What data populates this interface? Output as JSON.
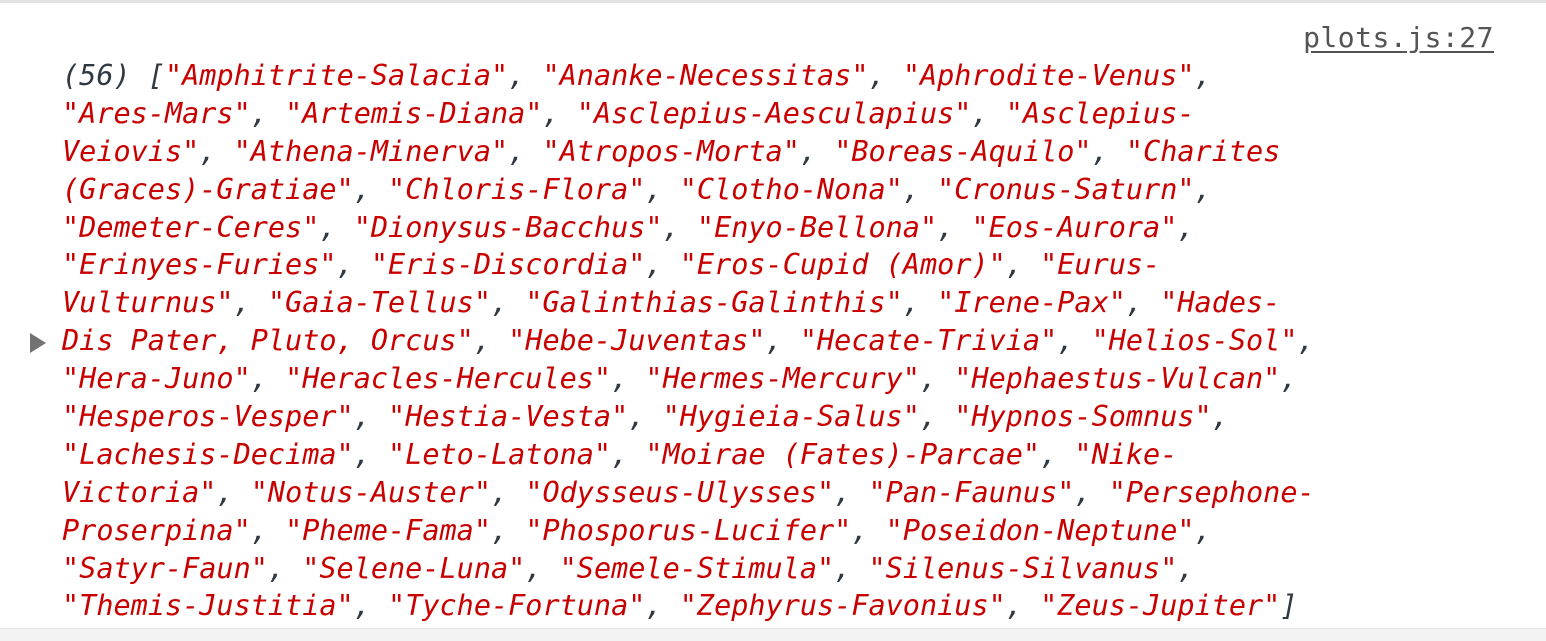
{
  "console": {
    "source_link": "plots.js:27",
    "array_length_label": "(56)",
    "open_bracket": "[",
    "close_bracket": "]",
    "lines": [
      [
        {
          "t": "s",
          "v": "\"Amphitrite-Salacia\""
        },
        {
          "t": "p",
          "v": ", "
        },
        {
          "t": "s",
          "v": "\"Ananke-Necessitas\""
        },
        {
          "t": "p",
          "v": ", "
        },
        {
          "t": "s",
          "v": "\"Aphrodite-Venus\""
        },
        {
          "t": "p",
          "v": ","
        }
      ],
      [
        {
          "t": "s",
          "v": "\"Ares-Mars\""
        },
        {
          "t": "p",
          "v": ", "
        },
        {
          "t": "s",
          "v": "\"Artemis-Diana\""
        },
        {
          "t": "p",
          "v": ", "
        },
        {
          "t": "s",
          "v": "\"Asclepius-Aesculapius\""
        },
        {
          "t": "p",
          "v": ", "
        },
        {
          "t": "s",
          "v": "\"Asclepius-"
        }
      ],
      [
        {
          "t": "s",
          "v": "Veiovis\""
        },
        {
          "t": "p",
          "v": ", "
        },
        {
          "t": "s",
          "v": "\"Athena-Minerva\""
        },
        {
          "t": "p",
          "v": ", "
        },
        {
          "t": "s",
          "v": "\"Atropos-Morta\""
        },
        {
          "t": "p",
          "v": ", "
        },
        {
          "t": "s",
          "v": "\"Boreas-Aquilo\""
        },
        {
          "t": "p",
          "v": ", "
        },
        {
          "t": "s",
          "v": "\"Charites"
        }
      ],
      [
        {
          "t": "s",
          "v": "(Graces)-Gratiae\""
        },
        {
          "t": "p",
          "v": ", "
        },
        {
          "t": "s",
          "v": "\"Chloris-Flora\""
        },
        {
          "t": "p",
          "v": ", "
        },
        {
          "t": "s",
          "v": "\"Clotho-Nona\""
        },
        {
          "t": "p",
          "v": ", "
        },
        {
          "t": "s",
          "v": "\"Cronus-Saturn\""
        },
        {
          "t": "p",
          "v": ","
        }
      ],
      [
        {
          "t": "s",
          "v": "\"Demeter-Ceres\""
        },
        {
          "t": "p",
          "v": ", "
        },
        {
          "t": "s",
          "v": "\"Dionysus-Bacchus\""
        },
        {
          "t": "p",
          "v": ", "
        },
        {
          "t": "s",
          "v": "\"Enyo-Bellona\""
        },
        {
          "t": "p",
          "v": ", "
        },
        {
          "t": "s",
          "v": "\"Eos-Aurora\""
        },
        {
          "t": "p",
          "v": ","
        }
      ],
      [
        {
          "t": "s",
          "v": "\"Erinyes-Furies\""
        },
        {
          "t": "p",
          "v": ", "
        },
        {
          "t": "s",
          "v": "\"Eris-Discordia\""
        },
        {
          "t": "p",
          "v": ", "
        },
        {
          "t": "s",
          "v": "\"Eros-Cupid (Amor)\""
        },
        {
          "t": "p",
          "v": ", "
        },
        {
          "t": "s",
          "v": "\"Eurus-"
        }
      ],
      [
        {
          "t": "s",
          "v": "Vulturnus\""
        },
        {
          "t": "p",
          "v": ", "
        },
        {
          "t": "s",
          "v": "\"Gaia-Tellus\""
        },
        {
          "t": "p",
          "v": ", "
        },
        {
          "t": "s",
          "v": "\"Galinthias-Galinthis\""
        },
        {
          "t": "p",
          "v": ", "
        },
        {
          "t": "s",
          "v": "\"Irene-Pax\""
        },
        {
          "t": "p",
          "v": ", "
        },
        {
          "t": "s",
          "v": "\"Hades-"
        }
      ],
      [
        {
          "t": "s",
          "v": "Dis Pater, Pluto, Orcus\""
        },
        {
          "t": "p",
          "v": ", "
        },
        {
          "t": "s",
          "v": "\"Hebe-Juventas\""
        },
        {
          "t": "p",
          "v": ", "
        },
        {
          "t": "s",
          "v": "\"Hecate-Trivia\""
        },
        {
          "t": "p",
          "v": ", "
        },
        {
          "t": "s",
          "v": "\"Helios-Sol\""
        },
        {
          "t": "p",
          "v": ","
        }
      ],
      [
        {
          "t": "s",
          "v": "\"Hera-Juno\""
        },
        {
          "t": "p",
          "v": ", "
        },
        {
          "t": "s",
          "v": "\"Heracles-Hercules\""
        },
        {
          "t": "p",
          "v": ", "
        },
        {
          "t": "s",
          "v": "\"Hermes-Mercury\""
        },
        {
          "t": "p",
          "v": ", "
        },
        {
          "t": "s",
          "v": "\"Hephaestus-Vulcan\""
        },
        {
          "t": "p",
          "v": ","
        }
      ],
      [
        {
          "t": "s",
          "v": "\"Hesperos-Vesper\""
        },
        {
          "t": "p",
          "v": ", "
        },
        {
          "t": "s",
          "v": "\"Hestia-Vesta\""
        },
        {
          "t": "p",
          "v": ", "
        },
        {
          "t": "s",
          "v": "\"Hygieia-Salus\""
        },
        {
          "t": "p",
          "v": ", "
        },
        {
          "t": "s",
          "v": "\"Hypnos-Somnus\""
        },
        {
          "t": "p",
          "v": ","
        }
      ],
      [
        {
          "t": "s",
          "v": "\"Lachesis-Decima\""
        },
        {
          "t": "p",
          "v": ", "
        },
        {
          "t": "s",
          "v": "\"Leto-Latona\""
        },
        {
          "t": "p",
          "v": ", "
        },
        {
          "t": "s",
          "v": "\"Moirae (Fates)-Parcae\""
        },
        {
          "t": "p",
          "v": ", "
        },
        {
          "t": "s",
          "v": "\"Nike-"
        }
      ],
      [
        {
          "t": "s",
          "v": "Victoria\""
        },
        {
          "t": "p",
          "v": ", "
        },
        {
          "t": "s",
          "v": "\"Notus-Auster\""
        },
        {
          "t": "p",
          "v": ", "
        },
        {
          "t": "s",
          "v": "\"Odysseus-Ulysses\""
        },
        {
          "t": "p",
          "v": ", "
        },
        {
          "t": "s",
          "v": "\"Pan-Faunus\""
        },
        {
          "t": "p",
          "v": ", "
        },
        {
          "t": "s",
          "v": "\"Persephone-"
        }
      ],
      [
        {
          "t": "s",
          "v": "Proserpina\""
        },
        {
          "t": "p",
          "v": ", "
        },
        {
          "t": "s",
          "v": "\"Pheme-Fama\""
        },
        {
          "t": "p",
          "v": ", "
        },
        {
          "t": "s",
          "v": "\"Phosporus-Lucifer\""
        },
        {
          "t": "p",
          "v": ", "
        },
        {
          "t": "s",
          "v": "\"Poseidon-Neptune\""
        },
        {
          "t": "p",
          "v": ","
        }
      ],
      [
        {
          "t": "s",
          "v": "\"Satyr-Faun\""
        },
        {
          "t": "p",
          "v": ", "
        },
        {
          "t": "s",
          "v": "\"Selene-Luna\""
        },
        {
          "t": "p",
          "v": ", "
        },
        {
          "t": "s",
          "v": "\"Semele-Stimula\""
        },
        {
          "t": "p",
          "v": ", "
        },
        {
          "t": "s",
          "v": "\"Silenus-Silvanus\""
        },
        {
          "t": "p",
          "v": ","
        }
      ],
      [
        {
          "t": "s",
          "v": "\"Themis-Justitia\""
        },
        {
          "t": "p",
          "v": ", "
        },
        {
          "t": "s",
          "v": "\"Tyche-Fortuna\""
        },
        {
          "t": "p",
          "v": ", "
        },
        {
          "t": "s",
          "v": "\"Zephyrus-Favonius\""
        },
        {
          "t": "p",
          "v": ", "
        },
        {
          "t": "s",
          "v": "\"Zeus-Jupiter\""
        }
      ]
    ]
  },
  "colors": {
    "string": "#c80000",
    "punctuation": "#303942",
    "link": "#545454",
    "arrow": "#727272"
  },
  "icons": {
    "expand": "triangle-right-icon"
  }
}
